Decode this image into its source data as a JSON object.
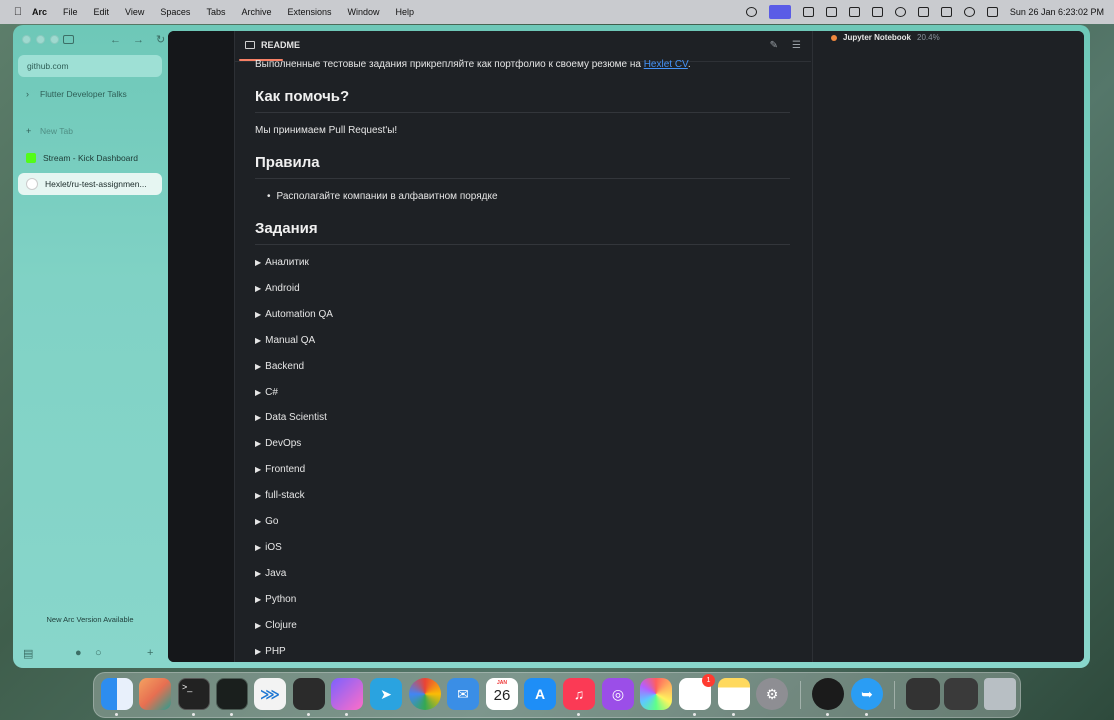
{
  "menubar": {
    "app": "Arc",
    "items": [
      "File",
      "Edit",
      "View",
      "Spaces",
      "Tabs",
      "Archive",
      "Extensions",
      "Window",
      "Help"
    ],
    "clock": "Sun 26 Jan  6:23:02 PM"
  },
  "sidebar": {
    "url": "github.com",
    "folder": "Flutter Developer Talks",
    "new_tab": "New Tab",
    "tabs": [
      {
        "label": "Stream - Kick Dashboard",
        "favicon_color": "#53fc18"
      },
      {
        "label": "Hexlet/ru-test-assignmen...",
        "favicon_color": "#ffffff"
      }
    ],
    "update_notice": "New Arc Version Available",
    "add_label": "+"
  },
  "readme": {
    "tab_title": "README",
    "intro_text": "Выполненные тестовые задания прикрепляйте как портфолио к своему резюме на ",
    "intro_link": "Hexlet CV",
    "intro_end": ".",
    "h_help": "Как помочь?",
    "help_text": "Мы принимаем Pull Request'ы!",
    "h_rules": "Правила",
    "rules": [
      "Располагайте компании в алфавитном порядке"
    ],
    "h_tasks": "Задания",
    "tasks": [
      "Аналитик",
      "Android",
      "Automation QA",
      "Manual QA",
      "Backend",
      "C#",
      "Data Scientist",
      "DevOps",
      "Frontend",
      "full-stack",
      "Go",
      "iOS",
      "Java",
      "Python",
      "Clojure",
      "PHP"
    ]
  },
  "right_panel": {
    "process_name": "Jupyter Notebook",
    "process_pct": "20.4%"
  },
  "dock": {
    "calendar_month": "JAN",
    "calendar_day": "26",
    "reminders_badge": "1"
  }
}
